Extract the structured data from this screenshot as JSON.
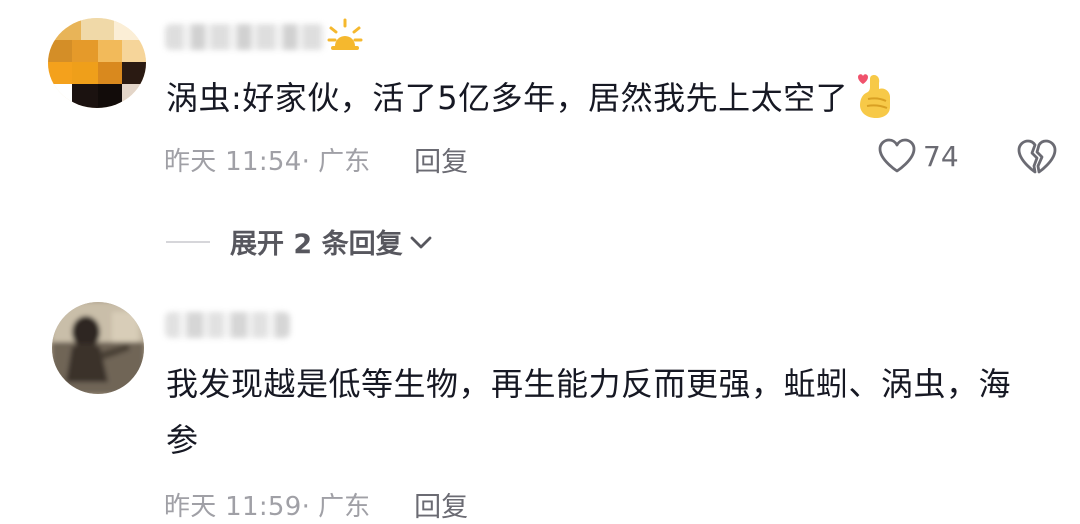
{
  "comments": [
    {
      "avatar_icon": "avatar-pixelated",
      "username_icon": "blurred-username",
      "badge_icon": "sun-emoji-icon",
      "text": "涡虫:好家伙，活了5亿多年，居然我先上太空了",
      "emoji_icon": "hand-heart-emoji-icon",
      "time": "昨天 11:54",
      "location": "· 广东",
      "reply_label": "回复",
      "like_icon": "heart-outline-icon",
      "like_count": "74",
      "dislike_icon": "broken-heart-icon"
    },
    {
      "avatar_icon": "avatar-blurred-photo",
      "username_icon": "blurred-username",
      "text": "我发现越是低等生物，再生能力反而更强，蚯蚓、涡虫，海参",
      "time": "昨天 11:59",
      "location": "· 广东",
      "reply_label": "回复"
    }
  ],
  "expand_replies": {
    "label": "展开 2 条回复",
    "icon": "chevron-down-icon"
  },
  "colors": {
    "text_primary": "#161823",
    "text_meta": "#a0a0a6",
    "reply": "#6b6b73",
    "heart_accent": "#f0526c",
    "emoji_yellow": "#f7c948"
  }
}
